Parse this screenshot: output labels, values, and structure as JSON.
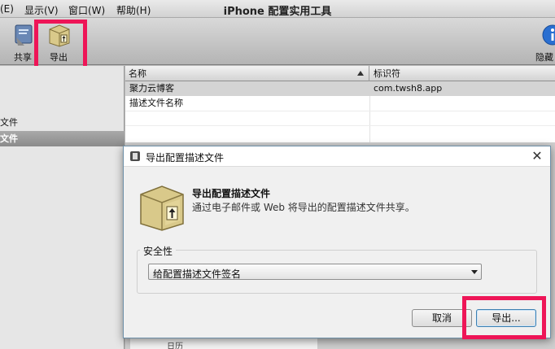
{
  "menubar": {
    "items": [
      "(E)",
      "显示(V)",
      "窗口(W)",
      "帮助(H)"
    ],
    "title": "iPhone 配置实用工具"
  },
  "toolbar": {
    "share_label": "共享",
    "export_label": "导出",
    "hide_label": "隐藏"
  },
  "sidebar": {
    "items": [
      "文件",
      "文件"
    ]
  },
  "table": {
    "headers": [
      "名称",
      "标识符"
    ],
    "rows": [
      {
        "name": "聚力云博客",
        "id": "com.twsh8.app"
      },
      {
        "name": "描述文件名称",
        "id": ""
      }
    ]
  },
  "lower_strip_text": "日历",
  "dialog": {
    "title": "导出配置描述文件",
    "heading": "导出配置描述文件",
    "description": "通过电子邮件或 Web 将导出的配置描述文件共享。",
    "security_label": "安全性",
    "security_value": "给配置描述文件签名",
    "cancel_label": "取消",
    "export_label": "导出..."
  },
  "highlight_color": "#ee1557"
}
